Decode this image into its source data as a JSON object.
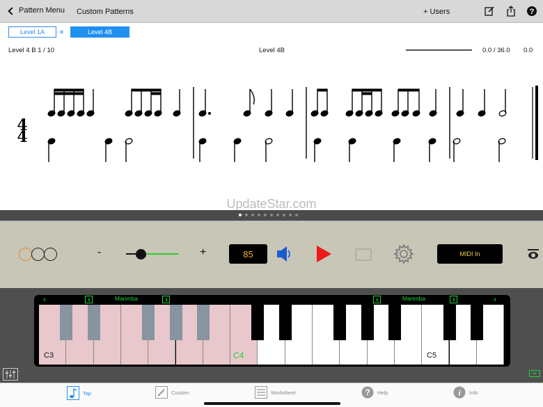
{
  "nav": {
    "back_label": "Pattern Menu",
    "title": "Custom Patterns",
    "users_label": "+ Users"
  },
  "level_tabs": {
    "tab_a": "Level 1A",
    "tab_b": "Level 4B",
    "close": "×"
  },
  "status": {
    "left": "Level 4 B 1 / 10",
    "center": "Level 4B",
    "progress": "0.0 / 36.0",
    "progress_fraction": 0,
    "tempo_value": "0.0"
  },
  "watermark": "UpdateStar.com",
  "pager": {
    "count": 10,
    "active_index": 0
  },
  "controls": {
    "minus": "-",
    "plus": "+",
    "tempo": "85",
    "midi_label": "MIDI In",
    "accent_color": "#e7872a",
    "selected_circle": 0
  },
  "keyboard": {
    "instrument_left": "Marimba",
    "instrument_right": "Marimba",
    "label_c3": "C3",
    "label_c4": "C4",
    "label_c5": "C5",
    "highlight_color": "#e8c8cc",
    "label_active_color": "#22d33a"
  },
  "tabbar": {
    "tap": "Tap",
    "custom": "Custom",
    "worksheet": "Worksheet",
    "help": "Help",
    "info": "Info"
  },
  "icons": {
    "edit": "edit-icon",
    "share": "share-icon",
    "help": "help-icon",
    "speaker": "speaker-icon",
    "play": "play-icon",
    "gear": "gear-icon"
  }
}
